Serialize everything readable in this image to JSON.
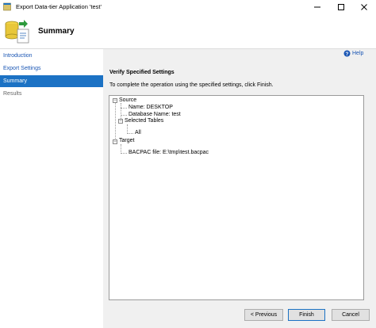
{
  "window": {
    "title": "Export Data-tier Application 'test'"
  },
  "header": {
    "title": "Summary"
  },
  "sidebar": {
    "items": [
      {
        "label": "Introduction"
      },
      {
        "label": "Export Settings"
      },
      {
        "label": "Summary"
      },
      {
        "label": "Results"
      }
    ]
  },
  "help": {
    "label": "Help"
  },
  "main": {
    "section_title": "Verify Specified Settings",
    "instruction": "To complete the operation using the specified settings, click Finish.",
    "tree": {
      "source": "Source",
      "name": "Name: DESKTOP",
      "database": "Database Name: test",
      "selected_tables": "Selected Tables",
      "all": "All",
      "target": "Target",
      "bacpac": "BACPAC file: E:\\tmp\\test.bacpac"
    }
  },
  "footer": {
    "previous": "< Previous",
    "finish": "Finish",
    "cancel": "Cancel"
  },
  "colors": {
    "accent": "#1c72c4",
    "link": "#1a56b4"
  }
}
